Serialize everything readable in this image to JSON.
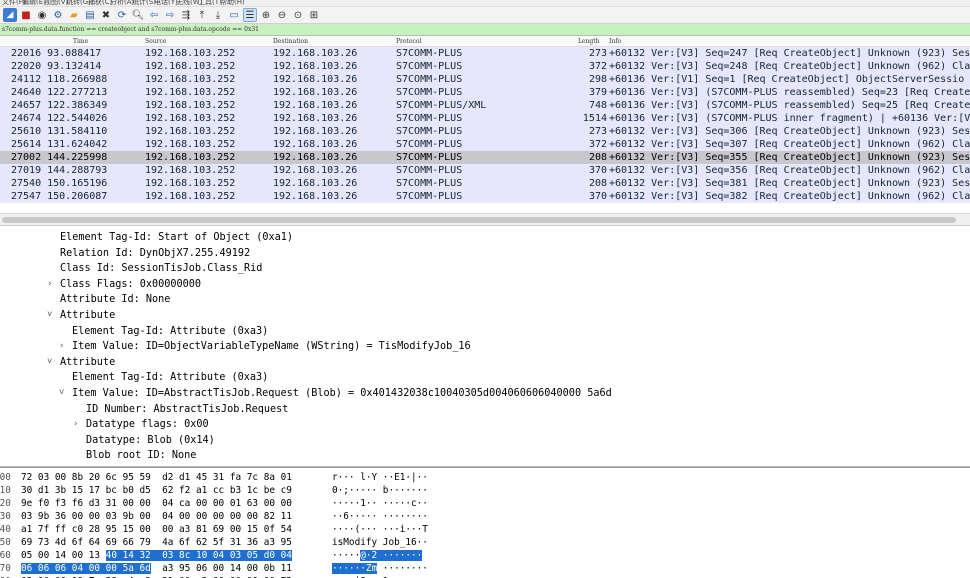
{
  "menubar": {
    "items": [
      "文件(F)",
      "编辑(E)",
      "视图(V)",
      "跳转(G)",
      "捕获(C)",
      "分析(A)",
      "统计(S)",
      "电话(Y)",
      "无线(W)",
      "工具(T)",
      "帮助(H)"
    ]
  },
  "toolbar": {
    "icons": [
      "shark-fin-icon",
      "stop-icon",
      "restart-icon",
      "options-icon",
      "open-folder-icon",
      "save-icon",
      "close-file-icon",
      "reload-icon",
      "find-icon",
      "back-icon",
      "forward-icon",
      "goto-icon",
      "first-icon",
      "last-icon",
      "autoscroll-icon",
      "colorize-icon",
      "zoom-in-icon",
      "zoom-out-icon",
      "zoom-reset-icon",
      "resize-columns-icon"
    ]
  },
  "filter": {
    "value": "s7comm-plus.data.function == createobject and s7comm-plus.data.opcode == 0x31"
  },
  "packet_list": {
    "headers": {
      "no": "",
      "time": "Time",
      "source": "Source",
      "destination": "Destination",
      "protocol": "Protocol",
      "length": "Length",
      "info": "Info"
    },
    "rows": [
      {
        "no": "22016",
        "time": "93.088417",
        "src": "192.168.103.252",
        "dst": "192.168.103.26",
        "proto": "S7COMM-PLUS",
        "len": "273",
        "info": "+60132 Ver:[V3] Seq=247 [Req CreateObject] Unknown (923) Ses"
      },
      {
        "no": "22020",
        "time": "93.132414",
        "src": "192.168.103.252",
        "dst": "192.168.103.26",
        "proto": "S7COMM-PLUS",
        "len": "372",
        "info": "+60132 Ver:[V3] Seq=248 [Req CreateObject] Unknown (962) Cla"
      },
      {
        "no": "24112",
        "time": "118.266988",
        "src": "192.168.103.252",
        "dst": "192.168.103.26",
        "proto": "S7COMM-PLUS",
        "len": "298",
        "info": "+60136 Ver:[V1] Seq=1 [Req CreateObject] ObjectServerSessio"
      },
      {
        "no": "24640",
        "time": "122.277213",
        "src": "192.168.103.252",
        "dst": "192.168.103.26",
        "proto": "S7COMM-PLUS",
        "len": "379",
        "info": "+60136 Ver:[V3] (S7COMM-PLUS reassembled) Seq=23 [Req Create"
      },
      {
        "no": "24657",
        "time": "122.386349",
        "src": "192.168.103.252",
        "dst": "192.168.103.26",
        "proto": "S7COMM-PLUS/XML",
        "len": "748",
        "info": "+60136 Ver:[V3] (S7COMM-PLUS reassembled) Seq=25 [Req Create"
      },
      {
        "no": "24674",
        "time": "122.544026",
        "src": "192.168.103.252",
        "dst": "192.168.103.26",
        "proto": "S7COMM-PLUS",
        "len": "1514",
        "info": "+60136 Ver:[V3] (S7COMM-PLUS inner fragment) | +60136 Ver:[V"
      },
      {
        "no": "25610",
        "time": "131.584110",
        "src": "192.168.103.252",
        "dst": "192.168.103.26",
        "proto": "S7COMM-PLUS",
        "len": "273",
        "info": "+60132 Ver:[V3] Seq=306 [Req CreateObject] Unknown (923) Ses"
      },
      {
        "no": "25614",
        "time": "131.624042",
        "src": "192.168.103.252",
        "dst": "192.168.103.26",
        "proto": "S7COMM-PLUS",
        "len": "372",
        "info": "+60132 Ver:[V3] Seq=307 [Req CreateObject] Unknown (962) Cla"
      },
      {
        "no": "27002",
        "time": "144.225998",
        "src": "192.168.103.252",
        "dst": "192.168.103.26",
        "proto": "S7COMM-PLUS",
        "len": "208",
        "info": "+60132 Ver:[V3] Seq=355 [Req CreateObject] Unknown (923) Ses",
        "selected": true
      },
      {
        "no": "27019",
        "time": "144.288793",
        "src": "192.168.103.252",
        "dst": "192.168.103.26",
        "proto": "S7COMM-PLUS",
        "len": "370",
        "info": "+60132 Ver:[V3] Seq=356 [Req CreateObject] Unknown (962) Cla"
      },
      {
        "no": "27540",
        "time": "150.165196",
        "src": "192.168.103.252",
        "dst": "192.168.103.26",
        "proto": "S7COMM-PLUS",
        "len": "208",
        "info": "+60132 Ver:[V3] Seq=381 [Req CreateObject] Unknown (923) Ses"
      },
      {
        "no": "27547",
        "time": "150.206087",
        "src": "192.168.103.252",
        "dst": "192.168.103.26",
        "proto": "S7COMM-PLUS",
        "len": "370",
        "info": "+60132 Ver:[V3] Seq=382 [Req CreateObject] Unknown (962) Cla"
      }
    ]
  },
  "details": [
    {
      "indent": 2,
      "arrow": "",
      "text": "Element Tag-Id: Start of Object (0xa1)"
    },
    {
      "indent": 2,
      "arrow": "",
      "text": "Relation Id: DynObjX7.255.49192"
    },
    {
      "indent": 2,
      "arrow": "",
      "text": "Class Id: SessionTisJob.Class_Rid"
    },
    {
      "indent": 2,
      "arrow": "›",
      "text": "Class Flags: 0x00000000"
    },
    {
      "indent": 2,
      "arrow": "",
      "text": "Attribute Id: None"
    },
    {
      "indent": 2,
      "arrow": "˅",
      "text": "Attribute"
    },
    {
      "indent": 3,
      "arrow": "",
      "text": "Element Tag-Id: Attribute (0xa3)"
    },
    {
      "indent": 3,
      "arrow": "›",
      "text": "Item Value: ID=ObjectVariableTypeName (WString) = TisModifyJob_16"
    },
    {
      "indent": 2,
      "arrow": "˅",
      "text": "Attribute"
    },
    {
      "indent": 3,
      "arrow": "",
      "text": "Element Tag-Id: Attribute (0xa3)"
    },
    {
      "indent": 3,
      "arrow": "˅",
      "text": "Item Value: ID=AbstractTisJob.Request (Blob) = 0x401432038c10040305d004060606040000 5a6d"
    },
    {
      "indent": 4,
      "arrow": "",
      "text": "ID Number: AbstractTisJob.Request"
    },
    {
      "indent": 4,
      "arrow": "›",
      "text": "Datatype flags: 0x00"
    },
    {
      "indent": 4,
      "arrow": "",
      "text": "Datatype: Blob (0x14)"
    },
    {
      "indent": 4,
      "arrow": "",
      "text": "Blob root ID: None"
    },
    {
      "indent": 4,
      "arrow": "",
      "text": "Blob size: 19"
    },
    {
      "indent": 4,
      "arrow": "",
      "text": "Value: 401432038c10040305d0040606060400005a6d",
      "selected": true
    },
    {
      "indent": 2,
      "arrow": "",
      "text": "Attribute"
    }
  ],
  "bytes": [
    {
      "off": "000",
      "hex": "72 03 00 8b 20 6c 95 59  d2 d1 45 31 fa 7c 8a 01",
      "asc": "r··· l·Y ··E1·|··"
    },
    {
      "off": "010",
      "hex": "30 d1 3b 15 17 bc b0 d5  62 f2 a1 cc b3 1c be c9",
      "asc": "0·;····· b·······"
    },
    {
      "off": "020",
      "hex": "9e f0 f3 f6 d3 31 00 00  04 ca 00 00 01 63 00 00",
      "asc": "·····1·· ·····c··"
    },
    {
      "off": "030",
      "hex": "03 9b 36 00 00 03 9b 00  04 00 00 00 00 00 82 11",
      "asc": "··6····· ········"
    },
    {
      "off": "040",
      "hex": "a1 7f ff c0 28 95 15 00  00 a3 81 69 00 15 0f 54",
      "asc": "····(··· ···i···T"
    },
    {
      "off": "050",
      "hex": "69 73 4d 6f 64 69 66 79  4a 6f 62 5f 31 36 a3 95",
      "asc": "isModify Job_16··"
    },
    {
      "off": "060",
      "hex": "05 00 14 00 13 ",
      "hex_hl": "40 14 32  03 8c 10 04 03 05 d0 04",
      "asc": "·····",
      "asc_hl": "@·2 ·······"
    },
    {
      "off": "070",
      "hex": "",
      "hex_hl": "06 06 06 04 00 00 5a 6d",
      "hex_tail": "  a3 95 06 00 14 00 0b 11",
      "asc": "",
      "asc_hl": "······Zm",
      "asc_tail": " ········"
    },
    {
      "off": "080",
      "hex": "03 00 00 19 7c 38 c4 e9  31 00 c3 00 00 00 00 72",
      "asc": "····|8·· 1······r"
    }
  ]
}
